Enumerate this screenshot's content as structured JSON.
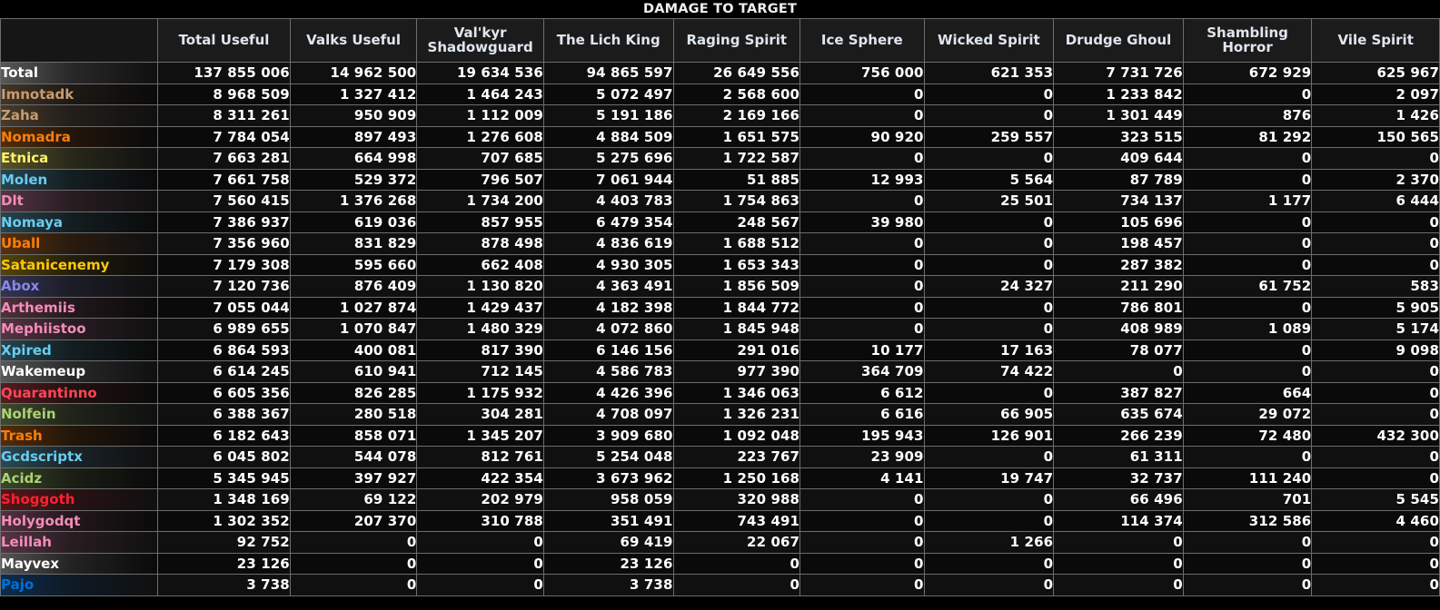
{
  "window": {
    "title": "DAMAGE TO TARGET"
  },
  "table": {
    "name_column_header": "",
    "columns": [
      "Total Useful",
      "Valks Useful",
      "Val'kyr Shadowguard",
      "The Lich King",
      "Raging Spirit",
      "Ice Sphere",
      "Wicked Spirit",
      "Drudge Ghoul",
      "Shambling Horror",
      "Vile Spirit"
    ],
    "rows": [
      {
        "name": "Total",
        "color": "#ffffff",
        "values": [
          "137 855 006",
          "14 962 500",
          "19 634 536",
          "94 865 597",
          "26 649 556",
          "756 000",
          "621 353",
          "7 731 726",
          "672 929",
          "625 967"
        ]
      },
      {
        "name": "Imnotadk",
        "color": "#c79c6e",
        "values": [
          "8 968 509",
          "1 327 412",
          "1 464 243",
          "5 072 497",
          "2 568 600",
          "0",
          "0",
          "1 233 842",
          "0",
          "2 097"
        ]
      },
      {
        "name": "Zaha",
        "color": "#c79c6e",
        "values": [
          "8 311 261",
          "950 909",
          "1 112 009",
          "5 191 186",
          "2 169 166",
          "0",
          "0",
          "1 301 449",
          "876",
          "1 426"
        ]
      },
      {
        "name": "Nomadra",
        "color": "#ff7d0a",
        "values": [
          "7 784 054",
          "897 493",
          "1 276 608",
          "4 884 509",
          "1 651 575",
          "90 920",
          "259 557",
          "323 515",
          "81 292",
          "150 565"
        ]
      },
      {
        "name": "Etnica",
        "color": "#fff569",
        "values": [
          "7 663 281",
          "664 998",
          "707 685",
          "5 275 696",
          "1 722 587",
          "0",
          "0",
          "409 644",
          "0",
          "0"
        ]
      },
      {
        "name": "Molen",
        "color": "#69ccf0",
        "values": [
          "7 661 758",
          "529 372",
          "796 507",
          "7 061 944",
          "51 885",
          "12 993",
          "5 564",
          "87 789",
          "0",
          "2 370"
        ]
      },
      {
        "name": "Dlt",
        "color": "#f58cba",
        "values": [
          "7 560 415",
          "1 376 268",
          "1 734 200",
          "4 403 783",
          "1 754 863",
          "0",
          "25 501",
          "734 137",
          "1 177",
          "6 444"
        ]
      },
      {
        "name": "Nomaya",
        "color": "#69ccf0",
        "values": [
          "7 386 937",
          "619 036",
          "857 955",
          "6 479 354",
          "248 567",
          "39 980",
          "0",
          "105 696",
          "0",
          "0"
        ]
      },
      {
        "name": "Uball",
        "color": "#ff7d0a",
        "values": [
          "7 356 960",
          "831 829",
          "878 498",
          "4 836 619",
          "1 688 512",
          "0",
          "0",
          "198 457",
          "0",
          "0"
        ]
      },
      {
        "name": "Satanicenemy",
        "color": "#ffc90a",
        "values": [
          "7 179 308",
          "595 660",
          "662 408",
          "4 930 305",
          "1 653 343",
          "0",
          "0",
          "287 382",
          "0",
          "0"
        ]
      },
      {
        "name": "Abox",
        "color": "#8787ed",
        "values": [
          "7 120 736",
          "876 409",
          "1 130 820",
          "4 363 491",
          "1 856 509",
          "0",
          "24 327",
          "211 290",
          "61 752",
          "583"
        ]
      },
      {
        "name": "Arthemiis",
        "color": "#f58cba",
        "values": [
          "7 055 044",
          "1 027 874",
          "1 429 437",
          "4 182 398",
          "1 844 772",
          "0",
          "0",
          "786 801",
          "0",
          "5 905"
        ]
      },
      {
        "name": "Mephiistoo",
        "color": "#f58cba",
        "values": [
          "6 989 655",
          "1 070 847",
          "1 480 329",
          "4 072 860",
          "1 845 948",
          "0",
          "0",
          "408 989",
          "1 089",
          "5 174"
        ]
      },
      {
        "name": "Xpired",
        "color": "#69ccf0",
        "values": [
          "6 864 593",
          "400 081",
          "817 390",
          "6 146 156",
          "291 016",
          "10 177",
          "17 163",
          "78 077",
          "0",
          "9 098"
        ]
      },
      {
        "name": "Wakemeup",
        "color": "#ffffff",
        "values": [
          "6 614 245",
          "610 941",
          "712 145",
          "4 586 783",
          "977 390",
          "364 709",
          "74 422",
          "0",
          "0",
          "0"
        ]
      },
      {
        "name": "Quarantinno",
        "color": "#ff4554",
        "values": [
          "6 605 356",
          "826 285",
          "1 175 932",
          "4 426 396",
          "1 346 063",
          "6 612",
          "0",
          "387 827",
          "664",
          "0"
        ]
      },
      {
        "name": "Nolfein",
        "color": "#aad372",
        "values": [
          "6 388 367",
          "280 518",
          "304 281",
          "4 708 097",
          "1 326 231",
          "6 616",
          "66 905",
          "635 674",
          "29 072",
          "0"
        ]
      },
      {
        "name": "Trash",
        "color": "#ff7d0a",
        "values": [
          "6 182 643",
          "858 071",
          "1 345 207",
          "3 909 680",
          "1 092 048",
          "195 943",
          "126 901",
          "266 239",
          "72 480",
          "432 300"
        ]
      },
      {
        "name": "Gcdscriptx",
        "color": "#69ccf0",
        "values": [
          "6 045 802",
          "544 078",
          "812 761",
          "5 254 048",
          "223 767",
          "23 909",
          "0",
          "61 311",
          "0",
          "0"
        ]
      },
      {
        "name": "Acidz",
        "color": "#aad372",
        "values": [
          "5 345 945",
          "397 927",
          "422 354",
          "3 673 962",
          "1 250 168",
          "4 141",
          "19 747",
          "32 737",
          "111 240",
          "0"
        ]
      },
      {
        "name": "Shoggoth",
        "color": "#ff2030",
        "values": [
          "1 348 169",
          "69 122",
          "202 979",
          "958 059",
          "320 988",
          "0",
          "0",
          "66 496",
          "701",
          "5 545"
        ]
      },
      {
        "name": "Holygodqt",
        "color": "#f58cba",
        "values": [
          "1 302 352",
          "207 370",
          "310 788",
          "351 491",
          "743 491",
          "0",
          "0",
          "114 374",
          "312 586",
          "4 460"
        ]
      },
      {
        "name": "Leillah",
        "color": "#f58cba",
        "values": [
          "92 752",
          "0",
          "0",
          "69 419",
          "22 067",
          "0",
          "1 266",
          "0",
          "0",
          "0"
        ]
      },
      {
        "name": "Mayvex",
        "color": "#ffffff",
        "values": [
          "23 126",
          "0",
          "0",
          "23 126",
          "0",
          "0",
          "0",
          "0",
          "0",
          "0"
        ]
      },
      {
        "name": "Pajo",
        "color": "#0070de",
        "values": [
          "3 738",
          "0",
          "0",
          "3 738",
          "0",
          "0",
          "0",
          "0",
          "0",
          "0"
        ]
      }
    ]
  }
}
